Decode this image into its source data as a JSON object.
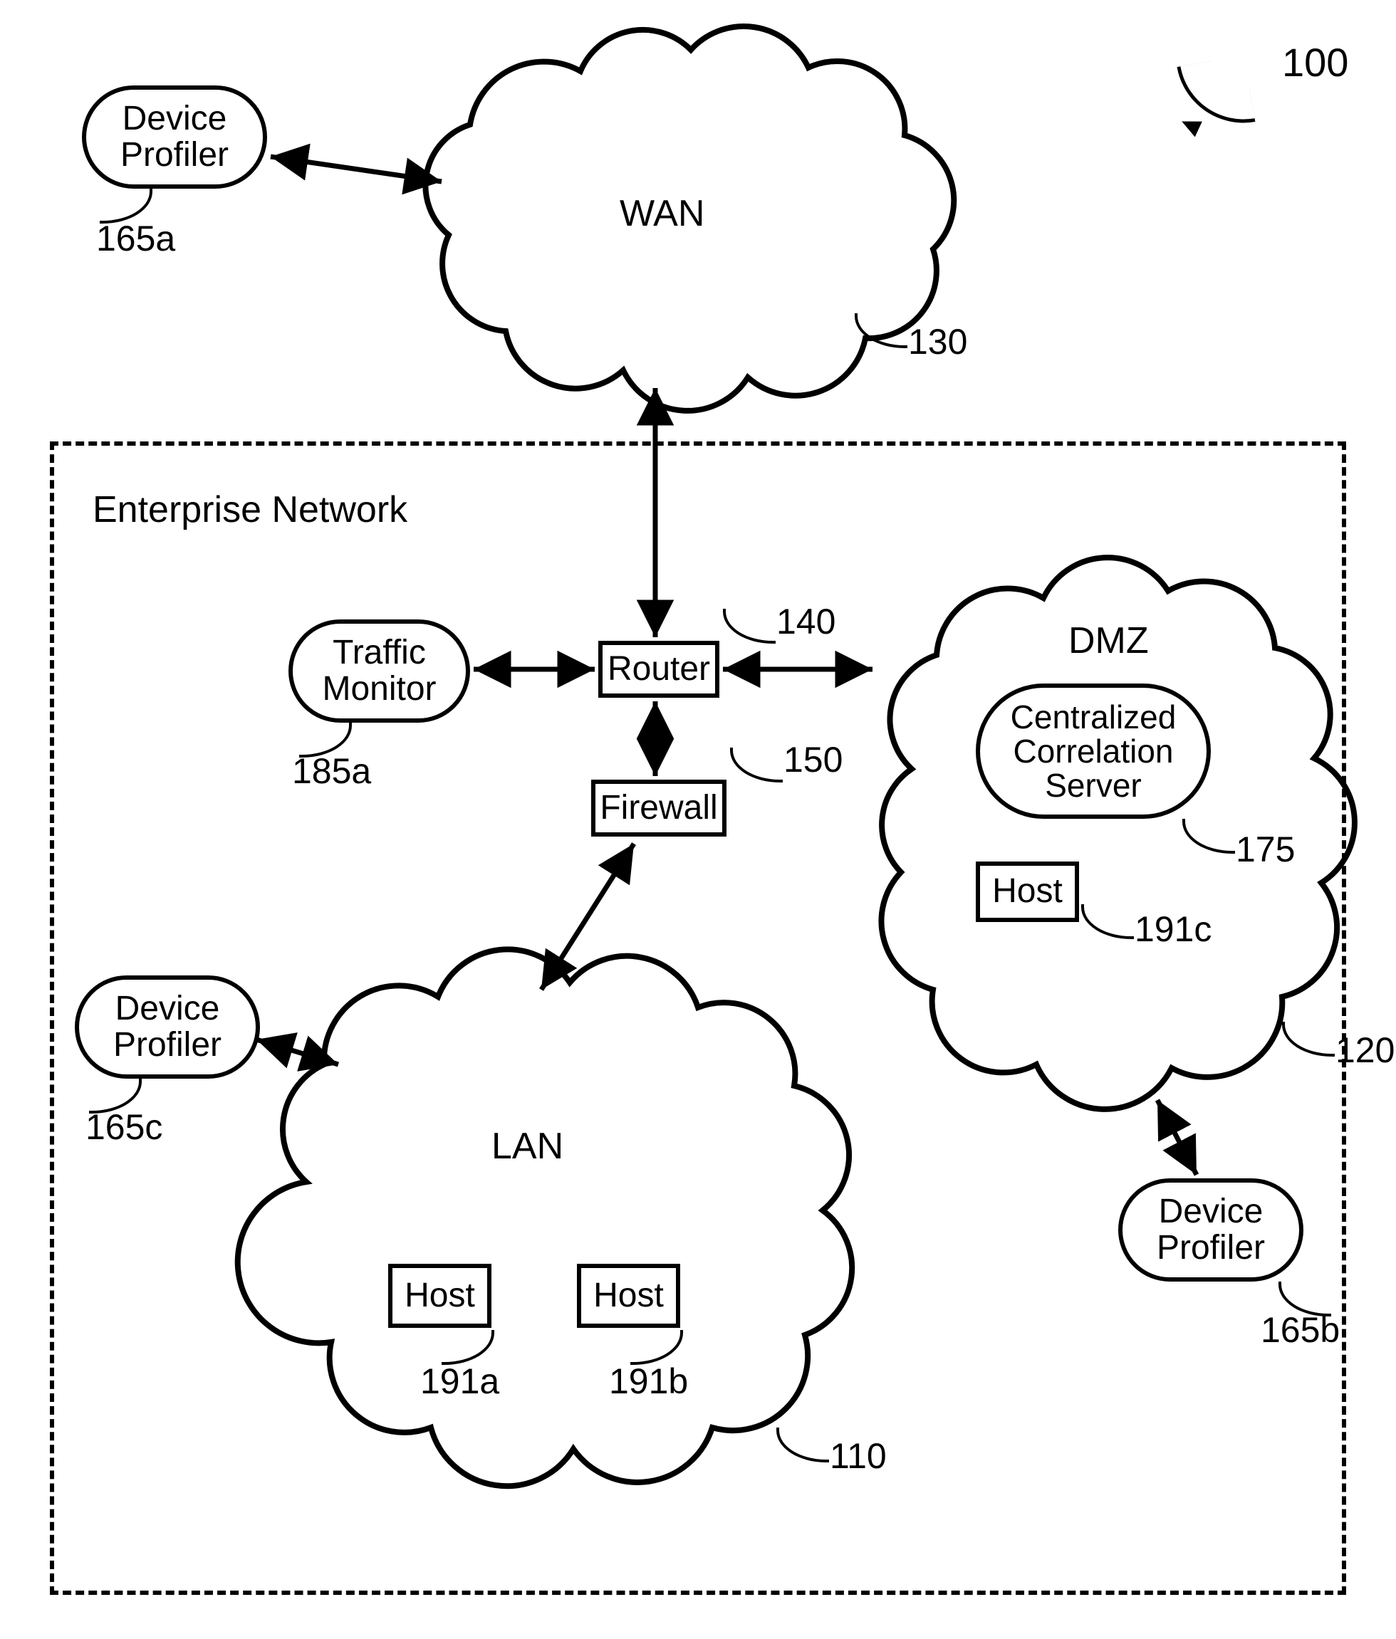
{
  "figure_ref": "100",
  "enterprise": {
    "title": "Enterprise Network"
  },
  "clouds": {
    "wan": {
      "label": "WAN",
      "ref": "130"
    },
    "dmz": {
      "label": "DMZ",
      "ref": "120"
    },
    "lan": {
      "label": "LAN",
      "ref": "110"
    }
  },
  "nodes": {
    "device_profiler_a": {
      "label": "Device\nProfiler",
      "ref": "165a"
    },
    "device_profiler_b": {
      "label": "Device\nProfiler",
      "ref": "165b"
    },
    "device_profiler_c": {
      "label": "Device\nProfiler",
      "ref": "165c"
    },
    "traffic_monitor": {
      "label": "Traffic\nMonitor",
      "ref": "185a"
    },
    "router": {
      "label": "Router",
      "ref": "140"
    },
    "firewall": {
      "label": "Firewall",
      "ref": "150"
    },
    "ccs": {
      "label": "Centralized\nCorrelation\nServer",
      "ref": "175"
    },
    "host_a": {
      "label": "Host",
      "ref": "191a"
    },
    "host_b": {
      "label": "Host",
      "ref": "191b"
    },
    "host_c": {
      "label": "Host",
      "ref": "191c"
    }
  }
}
